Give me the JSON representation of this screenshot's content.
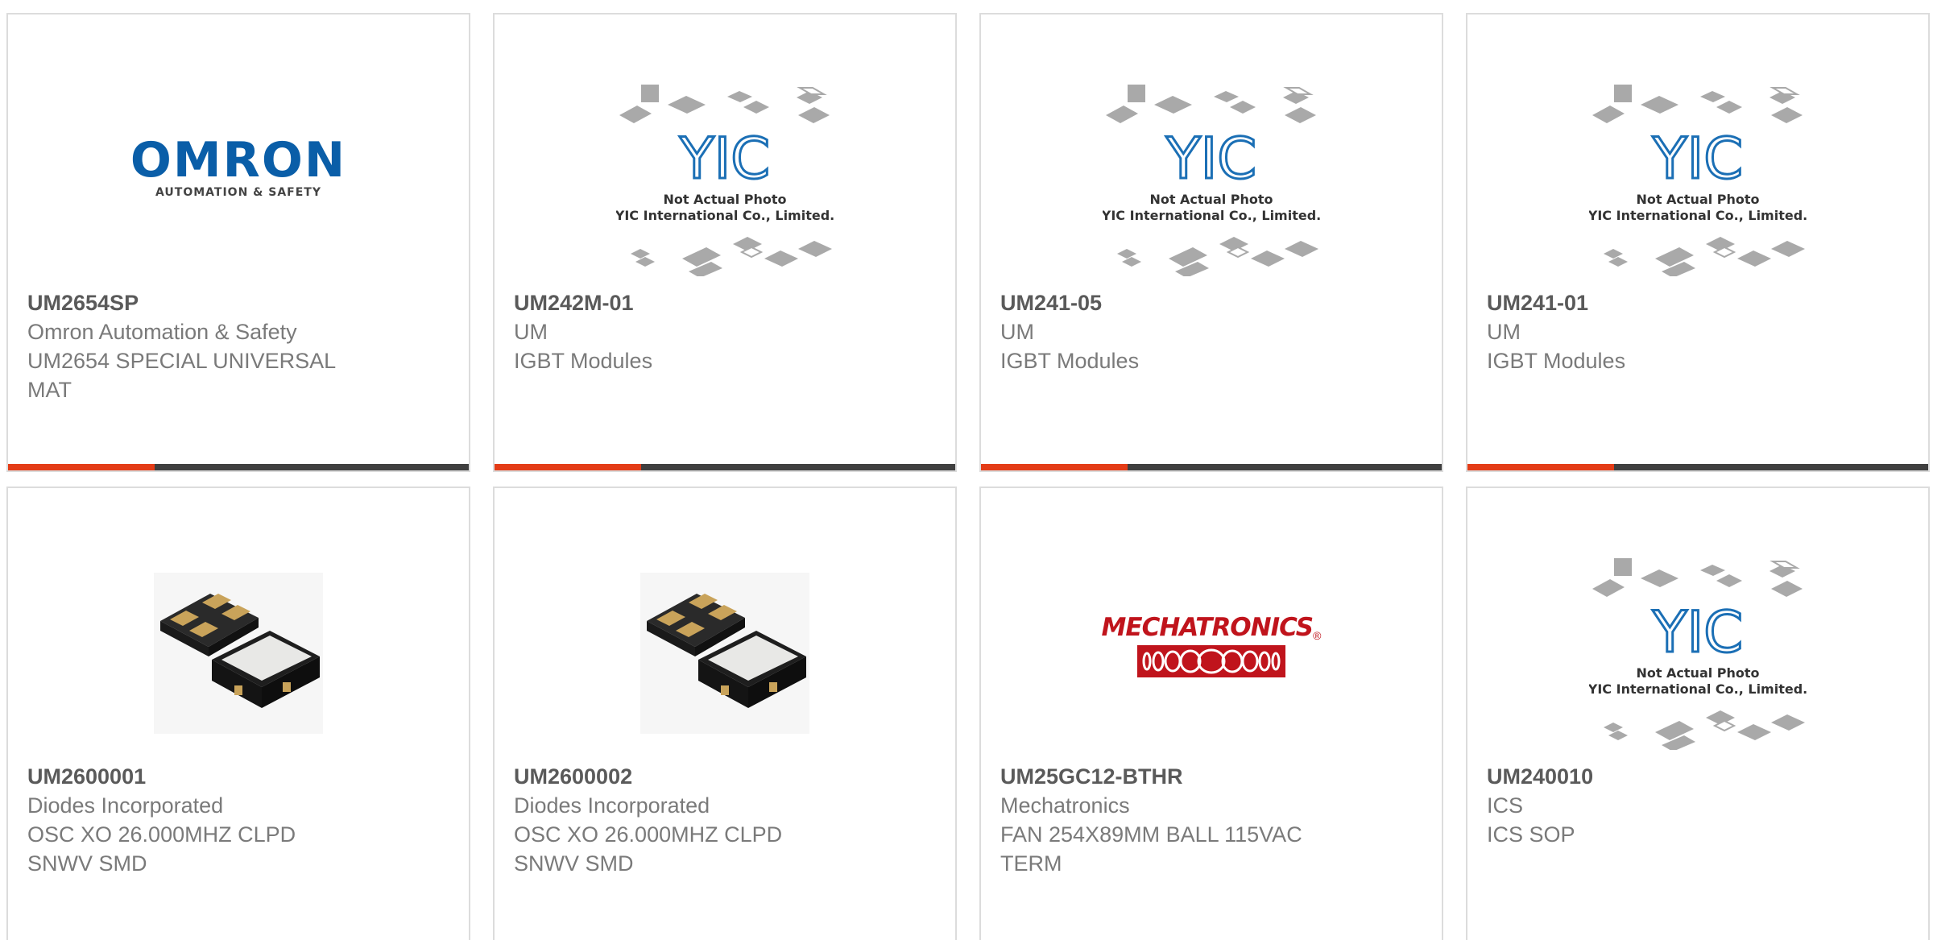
{
  "products": [
    {
      "part": "UM2654SP",
      "maker": "Omron Automation & Safety",
      "desc": "UM2654 SPECIAL UNIVERSAL MAT",
      "image": "omron-logo",
      "logo_word": "OMRON",
      "logo_sub": "AUTOMATION & SAFETY"
    },
    {
      "part": "UM242M-01",
      "maker": "UM",
      "desc": "IGBT Modules",
      "image": "placeholder-photo",
      "logo_word": "YIC",
      "caption1": "Not Actual Photo",
      "caption2": "YIC International Co., Limited."
    },
    {
      "part": "UM241-05",
      "maker": "UM",
      "desc": "IGBT Modules",
      "image": "placeholder-photo",
      "logo_word": "YIC",
      "caption1": "Not Actual Photo",
      "caption2": "YIC International Co., Limited."
    },
    {
      "part": "UM241-01",
      "maker": "UM",
      "desc": "IGBT Modules",
      "image": "placeholder-photo",
      "logo_word": "YIC",
      "caption1": "Not Actual Photo",
      "caption2": "YIC International Co., Limited."
    },
    {
      "part": "UM2600001",
      "maker": "Diodes Incorporated",
      "desc": "OSC XO 26.000MHZ CLPD SNWV SMD",
      "image": "oscillator-photo"
    },
    {
      "part": "UM2600002",
      "maker": "Diodes Incorporated",
      "desc": "OSC XO 26.000MHZ CLPD SNWV SMD",
      "image": "oscillator-photo"
    },
    {
      "part": "UM25GC12-BTHR",
      "maker": "Mechatronics",
      "desc": "FAN 254X89MM BALL 115VAC TERM",
      "image": "mechatronics-logo",
      "logo_word": "MECHATRONICS",
      "logo_reg": "®"
    },
    {
      "part": "UM240010",
      "maker": "ICS",
      "desc": "ICS SOP",
      "image": "placeholder-photo",
      "logo_word": "YIC",
      "caption1": "Not Actual Photo",
      "caption2": "YIC International Co., Limited."
    }
  ],
  "colors": {
    "accent": "#e43c17",
    "bar": "#3f3f3f",
    "omron_blue": "#0a5ea8",
    "yic_blue": "#1b6fb5",
    "mech_red": "#c0141c"
  }
}
